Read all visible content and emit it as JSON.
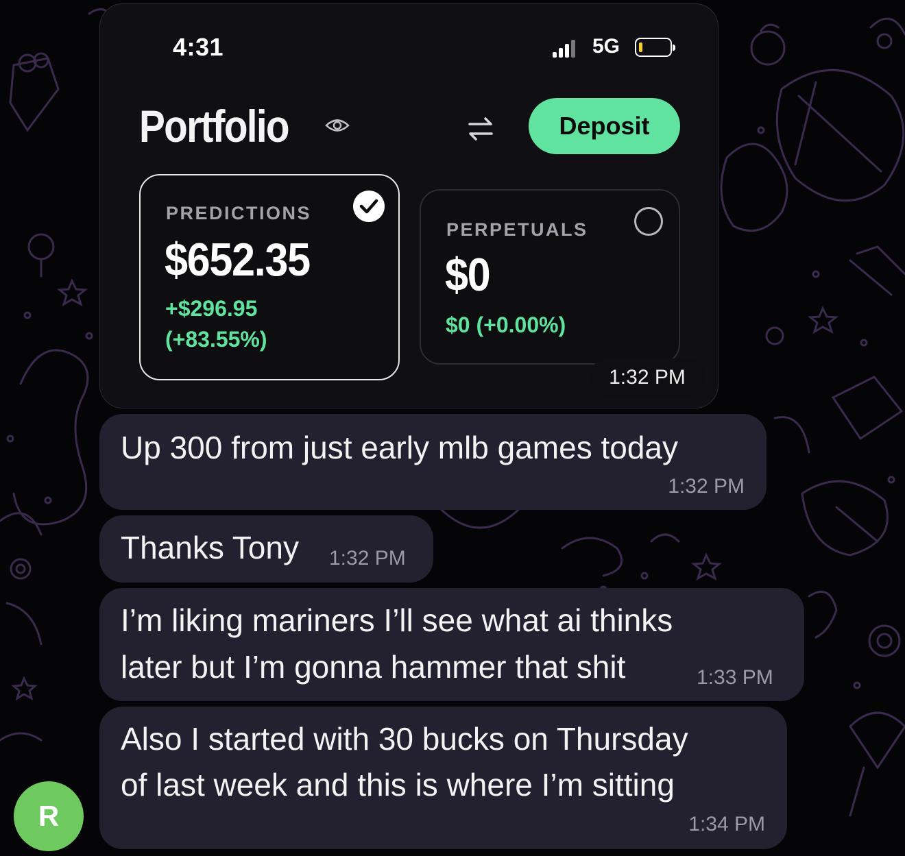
{
  "status_bar": {
    "time": "4:31",
    "network": "5G"
  },
  "portfolio": {
    "title": "Portfolio",
    "deposit_label": "Deposit",
    "predictions": {
      "label": "PREDICTIONS",
      "value": "$652.35",
      "change": "+$296.95",
      "change_pct": "(+83.55%)",
      "selected": true
    },
    "perpetuals": {
      "label": "PERPETUALS",
      "value": "$0",
      "change": "$0 (+0.00%)",
      "selected": false
    }
  },
  "messages": [
    {
      "time": "1:32 PM"
    },
    {
      "text": "Up 300 from just early mlb games today",
      "time": "1:32 PM"
    },
    {
      "text": "Thanks Tony",
      "time": "1:32 PM"
    },
    {
      "lines": [
        "I’m liking mariners I’ll see what ai thinks",
        "later but I’m gonna hammer that shit"
      ],
      "time": "1:33 PM"
    },
    {
      "lines": [
        "Also I started with 30 bucks on Thursday",
        "of last week and this is where I’m sitting"
      ],
      "time": "1:34 PM"
    }
  ],
  "sender": {
    "initial": "R",
    "avatar_color": "#6ec95e"
  },
  "colors": {
    "accent_green": "#5fe39f",
    "bubble": "#232130",
    "background": "#050507"
  }
}
